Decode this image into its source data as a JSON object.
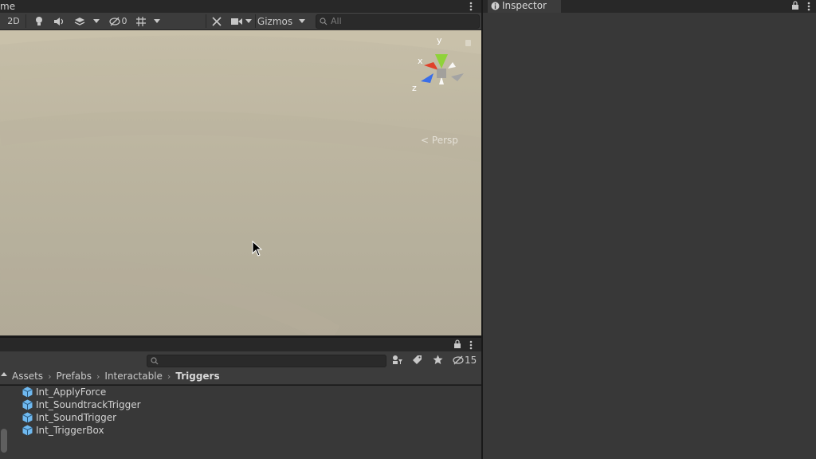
{
  "scene": {
    "tab_title": "me",
    "toolbar": {
      "btn_2d": "2D",
      "hidden_count": "0",
      "gizmos_label": "Gizmos",
      "search_placeholder": "All"
    },
    "gizmo": {
      "y_label": "y",
      "x_label": "x",
      "z_label": "z",
      "persp_label": "Persp"
    }
  },
  "inspector": {
    "tab_label": "Inspector"
  },
  "project": {
    "hidden_count": "15",
    "breadcrumb": [
      "Assets",
      "Prefabs",
      "Interactable",
      "Triggers"
    ],
    "files": [
      "Int_ApplyForce",
      "Int_SoundtrackTrigger",
      "Int_SoundTrigger",
      "Int_TriggerBox"
    ]
  },
  "colors": {
    "prefab_icon": "#6fb9f0",
    "axis_x": "#e0412b",
    "axis_y": "#8fd23a",
    "axis_z": "#3a6ee8"
  }
}
